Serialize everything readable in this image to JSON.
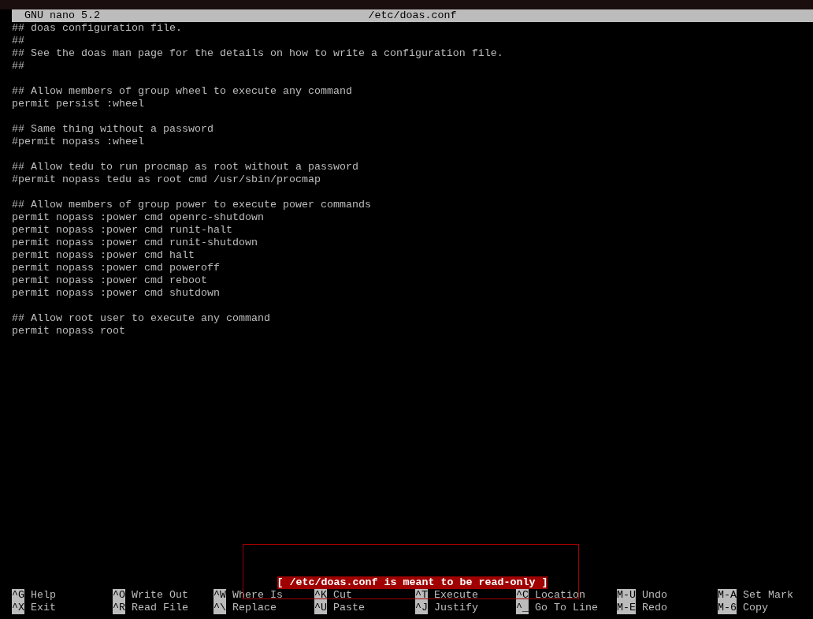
{
  "title_bar": {
    "version": "GNU nano 5.2",
    "filename": "/etc/doas.conf"
  },
  "editor": {
    "blocks": [
      [
        "## doas configuration file.",
        "##",
        "## See the doas man page for the details on how to write a configuration file.",
        "##"
      ],
      [
        "## Allow members of group wheel to execute any command",
        "permit persist :wheel"
      ],
      [
        "## Same thing without a password",
        "#permit nopass :wheel"
      ],
      [
        "## Allow tedu to run procmap as root without a password",
        "#permit nopass tedu as root cmd /usr/sbin/procmap"
      ],
      [
        "## Allow members of group power to execute power commands",
        "permit nopass :power cmd openrc-shutdown",
        "permit nopass :power cmd runit-halt",
        "permit nopass :power cmd runit-shutdown",
        "permit nopass :power cmd halt",
        "permit nopass :power cmd poweroff",
        "permit nopass :power cmd reboot",
        "permit nopass :power cmd shutdown"
      ],
      [
        "## Allow root user to execute any command",
        "permit nopass root"
      ]
    ]
  },
  "status_message": "[ /etc/doas.conf is meant to be read-only ]",
  "shortcuts": [
    {
      "key": "^G",
      "label": "Help"
    },
    {
      "key": "^O",
      "label": "Write Out"
    },
    {
      "key": "^W",
      "label": "Where Is"
    },
    {
      "key": "^K",
      "label": "Cut"
    },
    {
      "key": "^T",
      "label": "Execute"
    },
    {
      "key": "^C",
      "label": "Location"
    },
    {
      "key": "M-U",
      "label": "Undo"
    },
    {
      "key": "M-A",
      "label": "Set Mark"
    },
    {
      "key": "^X",
      "label": "Exit"
    },
    {
      "key": "^R",
      "label": "Read File"
    },
    {
      "key": "^\\",
      "label": "Replace"
    },
    {
      "key": "^U",
      "label": "Paste"
    },
    {
      "key": "^J",
      "label": "Justify"
    },
    {
      "key": "^_",
      "label": "Go To Line"
    },
    {
      "key": "M-E",
      "label": "Redo"
    },
    {
      "key": "M-6",
      "label": "Copy"
    }
  ]
}
